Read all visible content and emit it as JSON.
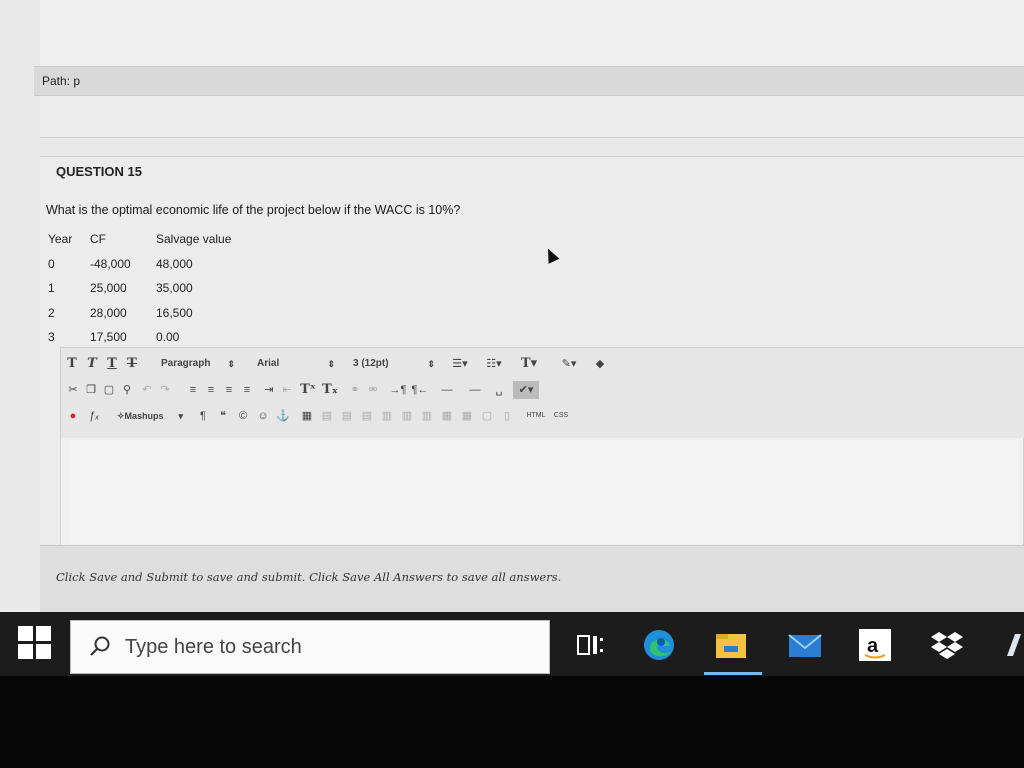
{
  "path": {
    "label": "Path: p"
  },
  "question": {
    "title": "QUESTION 15",
    "text": "What is the optimal economic life of the project below if the WACC is 10%?",
    "table": {
      "headers": [
        "Year",
        "CF",
        "Salvage value"
      ],
      "rows": [
        [
          "0",
          "-48,000",
          "48,000"
        ],
        [
          "1",
          "25,000",
          "35,000"
        ],
        [
          "2",
          "28,000",
          "16,500"
        ],
        [
          "3",
          "17,500",
          "0.00"
        ]
      ]
    }
  },
  "editor": {
    "format_select": "Paragraph",
    "font_select": "Arial",
    "size_select": "3 (12pt)",
    "mashups_label": "Mashups",
    "html_label": "HTML",
    "css_label": "CSS",
    "body_value": ""
  },
  "footer": {
    "instructions": "Click Save and Submit to save and submit. Click Save All Answers to save all answers."
  },
  "taskbar": {
    "search_placeholder": "Type here to search",
    "apps": [
      "task-view",
      "edge",
      "file-explorer",
      "mail",
      "amazon",
      "dropbox",
      "app"
    ]
  },
  "colors": {
    "page_bg": "#e9e9e9",
    "taskbar_bg": "#1c1c1c",
    "explorer_yellow": "#f4c243",
    "mail_blue": "#2b7cd3",
    "active_indicator": "#76b9ed"
  }
}
